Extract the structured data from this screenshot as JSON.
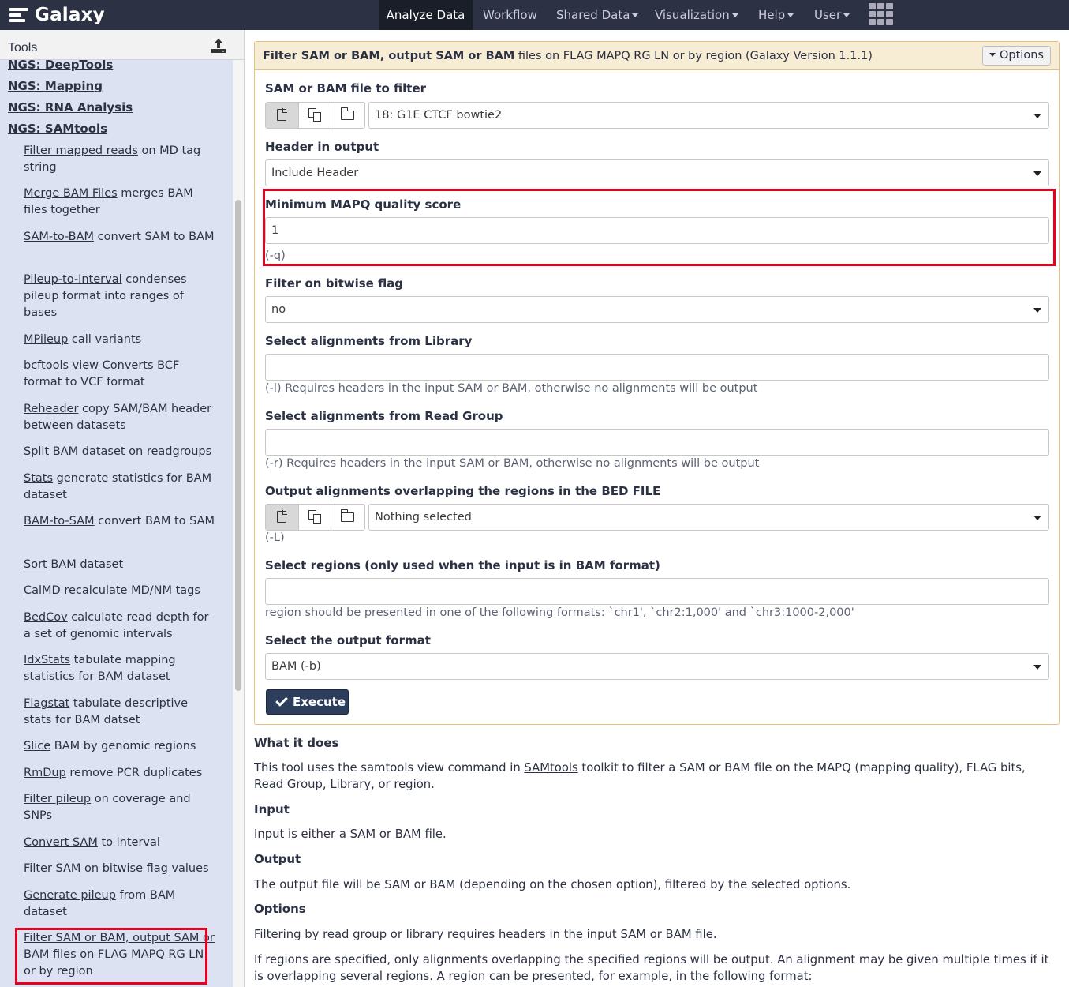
{
  "masthead": {
    "brand": "Galaxy",
    "nav": [
      {
        "label": "Analyze Data",
        "dropdown": false,
        "active": true
      },
      {
        "label": "Workflow",
        "dropdown": false
      },
      {
        "label": "Shared Data",
        "dropdown": true
      },
      {
        "label": "Visualization",
        "dropdown": true
      },
      {
        "label": "Help",
        "dropdown": true
      },
      {
        "label": "User",
        "dropdown": true
      }
    ],
    "apps_icon": "grid-icon"
  },
  "tool_panel": {
    "title": "Tools",
    "upload_icon": "upload-icon",
    "sections": [
      "NGS: DeepTools",
      "NGS: Mapping",
      "NGS: RNA Analysis",
      "NGS: SAMtools"
    ],
    "tools": [
      {
        "link": "Filter mapped reads",
        "desc": " on MD tag string"
      },
      {
        "link": "Merge BAM Files",
        "desc": " merges BAM files together"
      },
      {
        "link": "SAM-to-BAM",
        "desc": " convert SAM to BAM"
      },
      {
        "link": "Pileup-to-Interval",
        "desc": " condenses pileup format into ranges of bases"
      },
      {
        "link": "MPileup",
        "desc": " call variants"
      },
      {
        "link": "bcftools view",
        "desc": " Converts BCF format to VCF format"
      },
      {
        "link": "Reheader",
        "desc": " copy SAM/BAM header between datasets"
      },
      {
        "link": "Split",
        "desc": " BAM dataset on readgroups"
      },
      {
        "link": "Stats",
        "desc": " generate statistics for BAM dataset"
      },
      {
        "link": "BAM-to-SAM",
        "desc": " convert BAM to SAM"
      },
      {
        "link": "Sort",
        "desc": " BAM dataset"
      },
      {
        "link": "CalMD",
        "desc": " recalculate MD/NM tags"
      },
      {
        "link": "BedCov",
        "desc": " calculate read depth for a set of genomic intervals"
      },
      {
        "link": "IdxStats",
        "desc": " tabulate mapping statistics for BAM dataset"
      },
      {
        "link": "Flagstat",
        "desc": " tabulate descriptive stats for BAM datset"
      },
      {
        "link": "Slice",
        "desc": " BAM by genomic regions"
      },
      {
        "link": "RmDup",
        "desc": " remove PCR duplicates"
      },
      {
        "link": "Filter pileup",
        "desc": " on coverage and SNPs"
      },
      {
        "link": "Convert SAM",
        "desc": " to interval"
      },
      {
        "link": "Filter SAM",
        "desc": " on bitwise flag values"
      },
      {
        "link": "Generate pileup",
        "desc": " from BAM dataset"
      },
      {
        "link": "Filter SAM or BAM, output SAM or BAM",
        "desc": " files on FLAG MAPQ RG LN or by region"
      }
    ]
  },
  "form": {
    "title_bold": "Filter SAM or BAM, output SAM or BAM",
    "title_rest": " files on FLAG MAPQ RG LN or by region (Galaxy Version 1.1.1)",
    "options_label": "Options",
    "params": {
      "input": {
        "label": "SAM or BAM file to filter",
        "value": "18: G1E CTCF bowtie2"
      },
      "header": {
        "label": "Header in output",
        "value": "Include Header"
      },
      "mapq": {
        "label": "Minimum MAPQ quality score",
        "value": "1",
        "help": "(-q)"
      },
      "flag": {
        "label": "Filter on bitwise flag",
        "value": "no"
      },
      "library": {
        "label": "Select alignments from Library",
        "value": "",
        "help": "(-l) Requires headers in the input SAM or BAM, otherwise no alignments will be output"
      },
      "readgroup": {
        "label": "Select alignments from Read Group",
        "value": "",
        "help": "(-r) Requires headers in the input SAM or BAM, otherwise no alignments will be output"
      },
      "bed": {
        "label": "Output alignments overlapping the regions in the BED FILE",
        "value": "Nothing selected",
        "help": "(-L)"
      },
      "regions": {
        "label": "Select regions (only used when the input is in BAM format)",
        "value": "",
        "help": "region should be presented in one of the following formats: `chr1', `chr2:1,000' and `chr3:1000-2,000'"
      },
      "format": {
        "label": "Select the output format",
        "value": "BAM (-b)"
      }
    },
    "execute_label": "Execute"
  },
  "help_doc": {
    "what_heading": "What it does",
    "what_pre": "This tool uses the samtools view command in ",
    "what_link": "SAMtools",
    "what_post": " toolkit to filter a SAM or BAM file on the MAPQ (mapping quality), FLAG bits, Read Group, Library, or region.",
    "input_heading": "Input",
    "input_text": "Input is either a SAM or BAM file.",
    "output_heading": "Output",
    "output_text": "The output file will be SAM or BAM (depending on the chosen option), filtered by the selected options.",
    "options_heading": "Options",
    "options_text1": "Filtering by read group or library requires headers in the input SAM or BAM file.",
    "options_text2": "If regions are specified, only alignments overlapping the specified regions will be output. An alignment may be given multiple times if it is overlapping several regions. A region can be presented, for example, in the following format:"
  }
}
